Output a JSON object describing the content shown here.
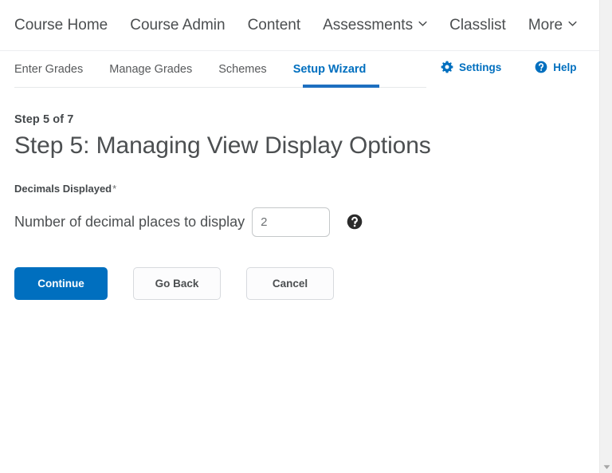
{
  "primary_nav": {
    "items": [
      {
        "label": "Course Home",
        "has_caret": false
      },
      {
        "label": "Course Admin",
        "has_caret": false
      },
      {
        "label": "Content",
        "has_caret": false
      },
      {
        "label": "Assessments",
        "has_caret": true
      },
      {
        "label": "Classlist",
        "has_caret": false
      },
      {
        "label": "More",
        "has_caret": true
      }
    ]
  },
  "tabs": {
    "items": [
      {
        "label": "Enter Grades",
        "active": false
      },
      {
        "label": "Manage Grades",
        "active": false
      },
      {
        "label": "Schemes",
        "active": false
      },
      {
        "label": "Setup Wizard",
        "active": true
      }
    ],
    "active_color": "#006fbf",
    "underline_color": "#1d6fc0"
  },
  "tool_links": {
    "settings": {
      "label": "Settings",
      "icon": "gear-icon"
    },
    "help": {
      "label": "Help",
      "icon": "question-circle-icon"
    },
    "color": "#006fbf"
  },
  "main": {
    "step_label": "Step 5 of 7",
    "page_title": "Step 5: Managing View Display Options",
    "field_legend": "Decimals Displayed",
    "required_mark": "*",
    "field_label": "Number of decimal places to display",
    "decimals_value": "2",
    "decimals_placeholder": "",
    "field_help_icon": "help-circle-icon"
  },
  "buttons": {
    "continue": "Continue",
    "go_back": "Go Back",
    "cancel": "Cancel",
    "primary_color": "#006fbf"
  },
  "scrollbar": {
    "down_arrow_icon": "chevron-down-icon"
  }
}
